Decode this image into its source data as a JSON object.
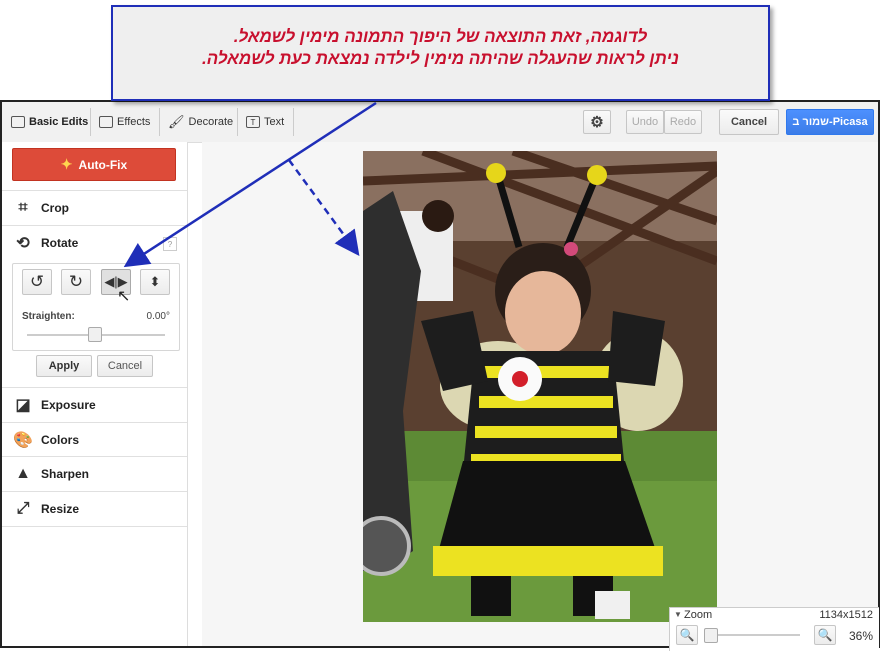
{
  "callout": {
    "line1": "לדוגמה, זאת התוצאה של היפוך התמונה מימין לשמאל.",
    "line2": "ניתן לראות שהעגלה שהיתה מימין לילדה נמצאת כעת לשמאלה.",
    "text_color": "#c8102e",
    "border_color": "#1f2eb8"
  },
  "toolbar": {
    "tabs": [
      {
        "label": "Basic Edits"
      },
      {
        "label": "Effects"
      },
      {
        "label": "Decorate"
      },
      {
        "label": "Text"
      }
    ],
    "undo_label": "Undo",
    "redo_label": "Redo",
    "cancel_label": "Cancel",
    "save_label": "שמור ב-Picasa"
  },
  "sidebar": {
    "autofix_label": "Auto-Fix",
    "crop_label": "Crop",
    "rotate_label": "Rotate",
    "straighten_label": "Straighten:",
    "straighten_value": "0.00°",
    "straighten_level": 0.5,
    "apply_label": "Apply",
    "cancel_label": "Cancel",
    "items": [
      {
        "label": "Exposure"
      },
      {
        "label": "Colors"
      },
      {
        "label": "Sharpen"
      },
      {
        "label": "Resize"
      }
    ]
  },
  "zoom": {
    "label": "Zoom",
    "dimensions": "1134x1512",
    "percent": "36%"
  },
  "colors": {
    "accent": "#dd4b39",
    "primary": "#4d90fe"
  }
}
